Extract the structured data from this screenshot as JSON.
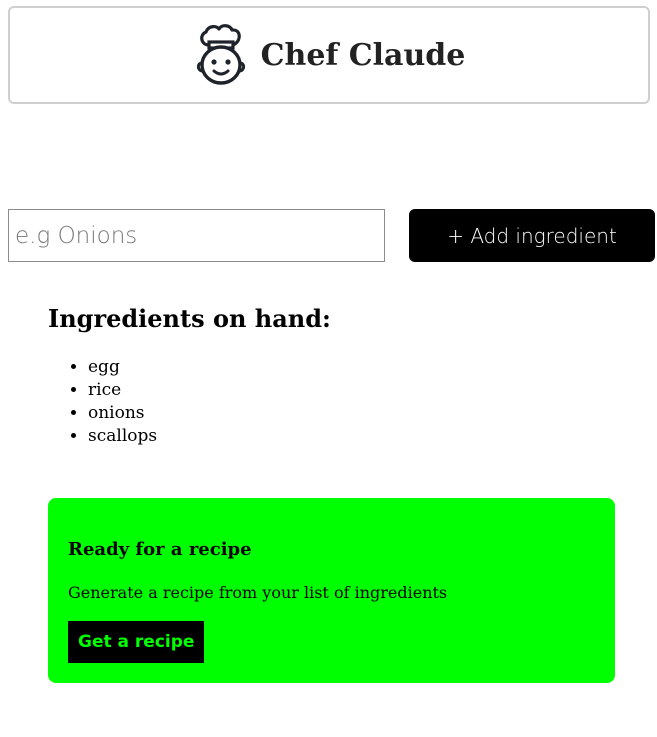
{
  "header": {
    "logo_icon": "chef-hat-face-icon",
    "title": "Chef Claude"
  },
  "form": {
    "input_placeholder": "e.g Onions",
    "input_value": "",
    "add_button_label": "+ Add ingredient"
  },
  "ingredients": {
    "heading": "Ingredients on hand:",
    "items": [
      "egg",
      "rice",
      "onions",
      "scallops"
    ]
  },
  "recipe_prompt": {
    "title": "Ready for a recipe",
    "description": "Generate a recipe from your list of ingredients",
    "button_label": "Get a recipe",
    "card_color": "#00ff00",
    "button_bg": "#000000",
    "button_text_color": "#00ff00"
  }
}
